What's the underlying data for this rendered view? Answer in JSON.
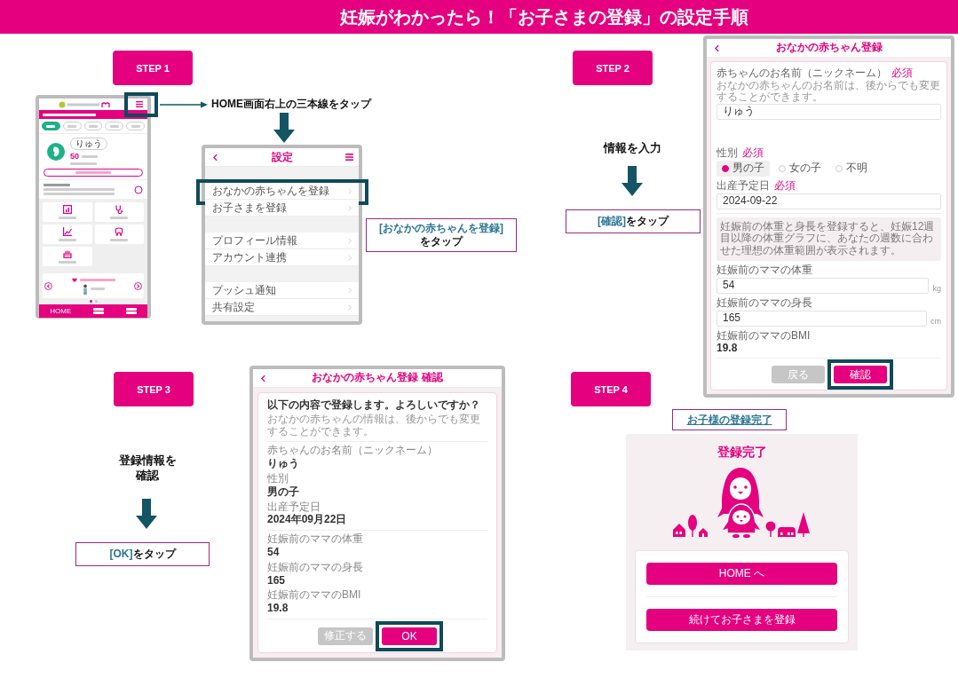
{
  "header": {
    "title": "妊娠がわかったら！「お子さまの登録」の設定手順"
  },
  "step1": {
    "badge": "STEP 1",
    "pointer_note": "HOME画面右上の三本線をタップ",
    "home_screen": {
      "menu_highlighted": true,
      "child_tabs": [
        {
          "selected": true
        },
        {
          "selected": false
        },
        {
          "selected": false
        },
        {
          "selected": false
        },
        {
          "selected": false
        }
      ],
      "child_name": "りゅう",
      "day_count": "50",
      "tiles": [
        {
          "kind": "chart"
        },
        {
          "kind": "stethoscope"
        },
        {
          "kind": "growth"
        },
        {
          "kind": "tooth"
        },
        {
          "kind": "cake"
        }
      ],
      "banner_pages": [
        {
          "selected": true
        },
        {
          "selected": false
        }
      ],
      "bottom_nav": [
        {
          "kind": "label",
          "label": "HOME"
        },
        {
          "kind": "blurred"
        },
        {
          "kind": "blurred"
        }
      ]
    },
    "settings_screen": {
      "title": "設定",
      "groups": [
        {
          "rows": [
            {
              "label": "おなかの赤ちゃんを登録",
              "highlighted": true
            },
            {
              "label": "お子さまを登録",
              "highlighted": false
            }
          ]
        },
        {
          "rows": [
            {
              "label": "プロフィール情報",
              "highlighted": false
            },
            {
              "label": "アカウント連携",
              "highlighted": false
            }
          ]
        },
        {
          "rows": [
            {
              "label": "プッシュ通知",
              "highlighted": false
            },
            {
              "label": "共有設定",
              "highlighted": false
            }
          ]
        }
      ]
    },
    "callout": {
      "lines": [
        [
          {
            "text": "[おなかの赤ちゃんを登録]",
            "kind": "emphasis"
          }
        ],
        [
          {
            "text": "をタップ",
            "kind": "plain"
          }
        ]
      ]
    }
  },
  "step2": {
    "badge": "STEP 2",
    "note": "情報を入力",
    "callout": {
      "lines": [
        [
          {
            "text": "[確認]",
            "kind": "emphasis"
          },
          {
            "text": "をタップ",
            "kind": "plain"
          }
        ]
      ]
    },
    "form_screen": {
      "title": "おなかの赤ちゃん登録",
      "fields": [
        {
          "kind": "text",
          "label": "赤ちゃんのお名前（ニックネーム）",
          "required": "必須",
          "hint": "おなかの赤ちゃんのお名前は、後からでも変更することができます。",
          "value": "りゅう"
        },
        {
          "kind": "radio",
          "label": "性別",
          "required": "必須",
          "options": [
            {
              "label": "男の子",
              "selected": true
            },
            {
              "label": "女の子",
              "selected": false
            },
            {
              "label": "不明",
              "selected": false
            }
          ]
        },
        {
          "kind": "text",
          "label": "出産予定日",
          "required": "必須",
          "value": "2024-09-22"
        },
        {
          "kind": "info",
          "text": "妊娠前の体重と身長を登録すると、妊娠12週目以降の体重グラフに、あなたの週数に合わせた理想の体重範囲が表示されます。"
        },
        {
          "kind": "unit",
          "label": "妊娠前のママの体重",
          "value": "54",
          "unit": "kg"
        },
        {
          "kind": "unit",
          "label": "妊娠前のママの身長",
          "value": "165",
          "unit": "cm"
        },
        {
          "kind": "readout",
          "label": "妊娠前のママのBMI",
          "value": "19.8"
        }
      ],
      "buttons": [
        {
          "label": "戻る",
          "kind": "secondary",
          "highlighted": false
        },
        {
          "label": "確認",
          "kind": "primary",
          "highlighted": true
        }
      ]
    }
  },
  "step3": {
    "badge": "STEP 3",
    "note_lines": [
      "登録情報を",
      "確認"
    ],
    "callout": {
      "lines": [
        [
          {
            "text": "[OK]",
            "kind": "emphasis"
          },
          {
            "text": "をタップ",
            "kind": "plain"
          }
        ]
      ]
    },
    "confirm_screen": {
      "title": "おなかの赤ちゃん登録 確認",
      "intro": "以下の内容で登録します。よろしいですか？",
      "note": "おなかの赤ちゃんの情報は、後からでも変更することができます。",
      "groups": [
        {
          "items": [
            {
              "label": "赤ちゃんのお名前（ニックネーム）",
              "value": "りゅう"
            },
            {
              "label": "性別",
              "value": "男の子"
            },
            {
              "label": "出産予定日",
              "value": "2024年09月22日"
            }
          ]
        },
        {
          "items": [
            {
              "label": "妊娠前のママの体重",
              "value": "54"
            },
            {
              "label": "妊娠前のママの身長",
              "value": "165"
            },
            {
              "label": "妊娠前のママのBMI",
              "value": "19.8"
            }
          ]
        }
      ],
      "buttons": [
        {
          "label": "修正する",
          "kind": "secondary",
          "highlighted": false
        },
        {
          "label": "OK",
          "kind": "primary",
          "highlighted": true
        }
      ]
    }
  },
  "step4": {
    "badge": "STEP 4",
    "callout": {
      "lines": [
        [
          {
            "text": "お子様の登録完了",
            "kind": "link"
          }
        ]
      ]
    },
    "done_screen": {
      "title": "登録完了",
      "buttons": [
        {
          "label": "HOME へ",
          "kind": "primary"
        },
        {
          "label": "続けてお子さまを登録",
          "kind": "primary"
        }
      ]
    }
  }
}
